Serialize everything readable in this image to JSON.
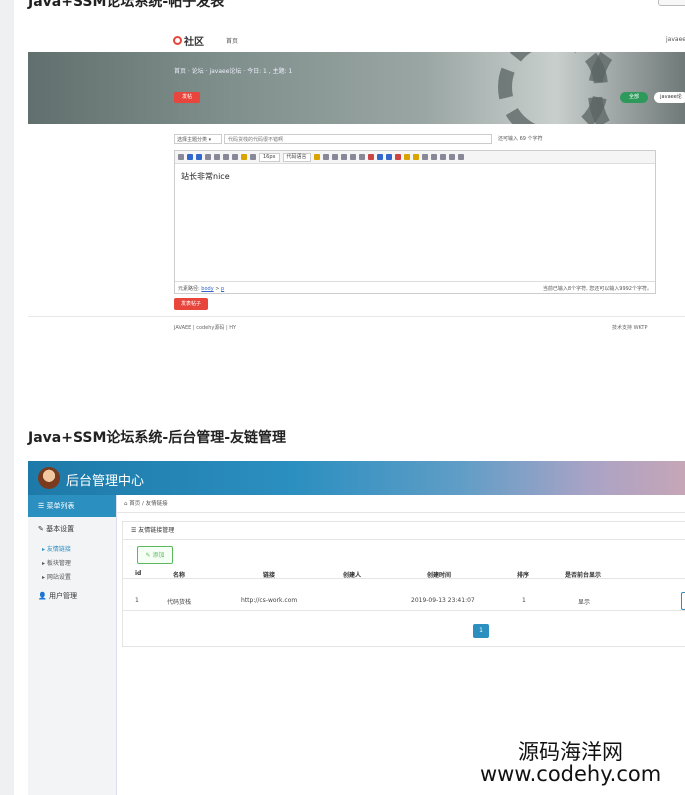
{
  "section1": {
    "heading": "Java+SSM论坛系统-帖子发表"
  },
  "forum": {
    "logo_text": "社区",
    "nav_home": "首页",
    "nav_right": "javaee",
    "breadcrumb": "首页 · 论坛 · javaee论坛 · 今日: 1 , 主题: 1",
    "banner_button": "发帖",
    "tag_green": "全部",
    "tag_white": "javaee论",
    "category_select": "选择主题分类 ▾",
    "title_input": "代码货栈的代码很不错啊",
    "remaining": "还可输入 69 个字符",
    "toolbar": {
      "fontsize": "16px",
      "codelang": "代码语言"
    },
    "editor_content": "站长非常nice",
    "status_path_label": "元素路径:",
    "status_path_link1": "body",
    "status_path_link2": "p",
    "status_right": "当前已输入8个字符, 您还可以输入9992个字符。",
    "submit_button": "发表帖子",
    "footer": "JAVAEE   |   codehy源码   |   HY",
    "footer_right": "技术支持 WKTP"
  },
  "section2": {
    "heading": "Java+SSM论坛系统-后台管理-友链管理"
  },
  "admin": {
    "title": "后台管理中心",
    "sidebar": {
      "menu_label": "菜单列表",
      "basic_settings": "基本设置",
      "sub_items": [
        "友情链接",
        "板块管理",
        "网站设置"
      ],
      "user_manage": "用户管理"
    },
    "breadcrumb": "首页   /   友情链接",
    "panel_title": "友情链接管理",
    "add_button": "添加",
    "columns": [
      "id",
      "名称",
      "链接",
      "创建人",
      "创建时间",
      "排序",
      "是否前台显示"
    ],
    "rows": [
      [
        "1",
        "代码货栈",
        "http://cs-work.com",
        "",
        "2019-09-13 23:41:07",
        "1",
        "显示"
      ]
    ],
    "page": "1"
  },
  "watermark": {
    "line1": "源码海洋网",
    "line2": "www.codehy.com"
  }
}
